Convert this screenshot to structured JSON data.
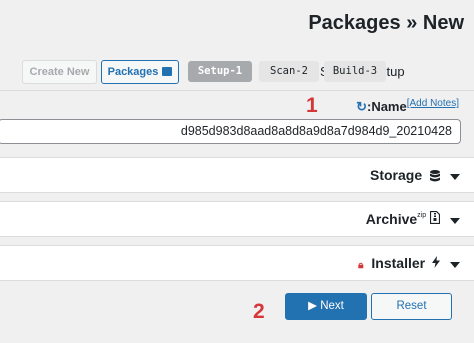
{
  "header": {
    "title": "Packages » New"
  },
  "toolbar": {
    "create_new_label": "Create New",
    "packages_label": "Packages"
  },
  "steps": [
    {
      "label": "Setup-1",
      "state": "active"
    },
    {
      "label": "Scan-2",
      "state": "inactive"
    },
    {
      "label": "Build-3",
      "state": "inactive"
    }
  ],
  "steps_tail_text": "S  ckage Setup",
  "name_section": {
    "label": ":Name",
    "add_notes_link": "[Add Notes]",
    "value": "d985d983d8aad8a8d8a9d8a7d984d9_20210428"
  },
  "panels": {
    "storage": {
      "title": "Storage",
      "icon": "database-icon"
    },
    "archive": {
      "title": "Archive",
      "superscript": "zip",
      "icon": "zip-file-icon"
    },
    "installer": {
      "title": "Installer",
      "icon": "bolt-icon",
      "lock_icon": "lock-icon"
    }
  },
  "markers": {
    "first": "1",
    "second": "2"
  },
  "actions": {
    "next_label": "▶ Next",
    "reset_label": "Reset"
  },
  "colors": {
    "accent": "#2271b1",
    "marker": "#d63638",
    "inactive_step": "#a7aaad"
  }
}
